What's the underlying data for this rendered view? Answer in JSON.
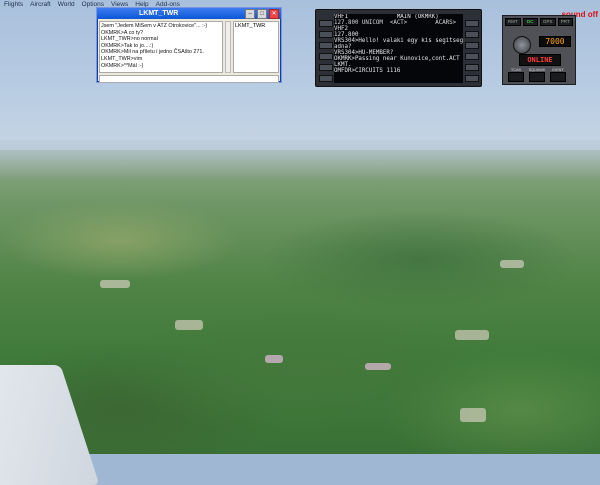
{
  "menu": [
    "Flights",
    "Aircraft",
    "World",
    "Options",
    "Views",
    "Help",
    "Add-ons"
  ],
  "sound_status": "sound off",
  "chat": {
    "title": "LKMT_TWR",
    "messages": [
      "Jsem \"Jedem MiSem v ATZ Otrokovice\"... :-)",
      "OKMRK>A co ty?",
      "LKMT_TWR>no normal",
      "OKMRK>Tak to jo....:)",
      "OKMRK>Mil na příletu i jedno ČSAšto 271.",
      "LKMT_TWR>vim",
      "OKMRK>**Mál :-)"
    ],
    "users": [
      "LKMT_TWR"
    ]
  },
  "fmc": {
    "lines": [
      "VHF1              MAIN (OKMRK)",
      "127.800 UNICOM  <ACT>        ACARS>",
      "VHF2",
      "127.800",
      "VRS304>Hello! valaki egy kis segitseget",
      "adna?",
      "VRS304>HU-MEMBER?",
      "OKMRK>Passing near Kunovice,cont.ACT to",
      "LKMT.",
      "OMFDR>CIRCUITS 1116"
    ]
  },
  "radio": {
    "buttons": [
      "RMT",
      "DC",
      "GPS",
      "PRT"
    ],
    "frequency": "7000",
    "status": "ONLINE",
    "switch_labels": [
      "TCAS",
      "SQUAWK",
      "IDENT"
    ]
  }
}
